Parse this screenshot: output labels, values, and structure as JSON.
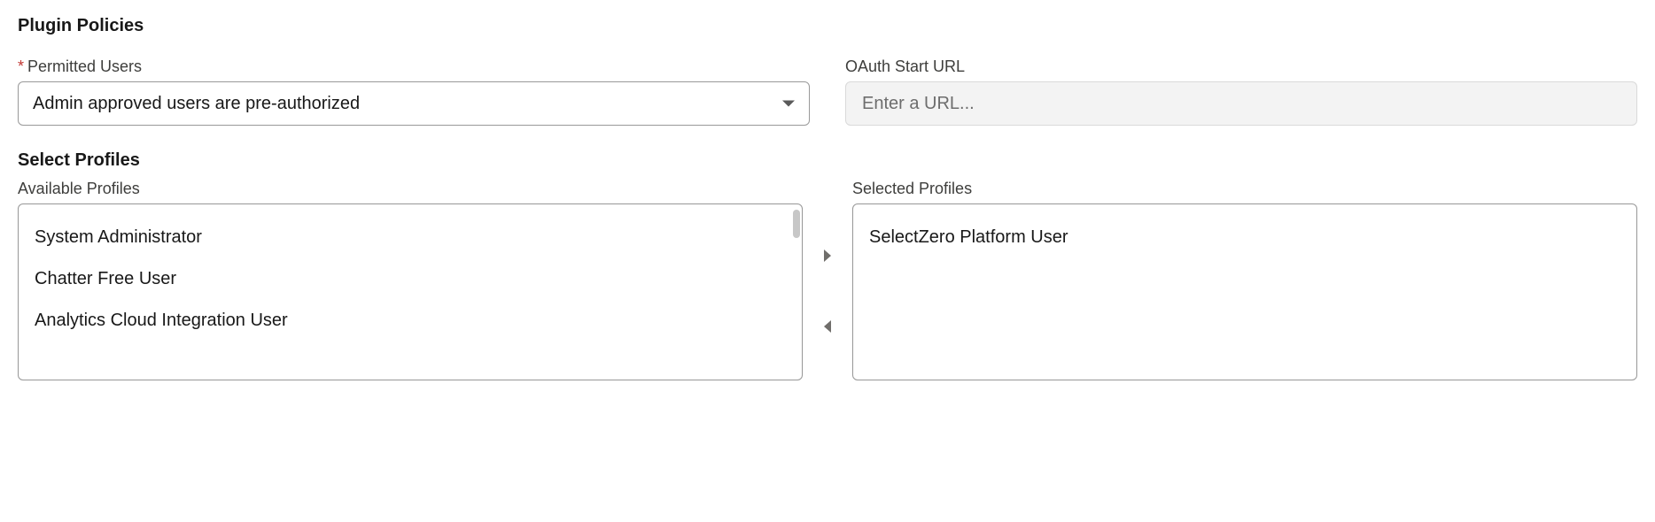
{
  "section": {
    "title": "Plugin Policies",
    "permitted_label": "Permitted Users",
    "permitted_value": "Admin approved users are pre-authorized",
    "oauth_label": "OAuth Start URL",
    "oauth_placeholder": "Enter a URL..."
  },
  "profiles": {
    "title": "Select Profiles",
    "available_label": "Available Profiles",
    "selected_label": "Selected Profiles",
    "available": [
      "System Administrator",
      "Chatter Free User",
      "Analytics Cloud Integration User"
    ],
    "selected": [
      "SelectZero Platform User"
    ]
  }
}
